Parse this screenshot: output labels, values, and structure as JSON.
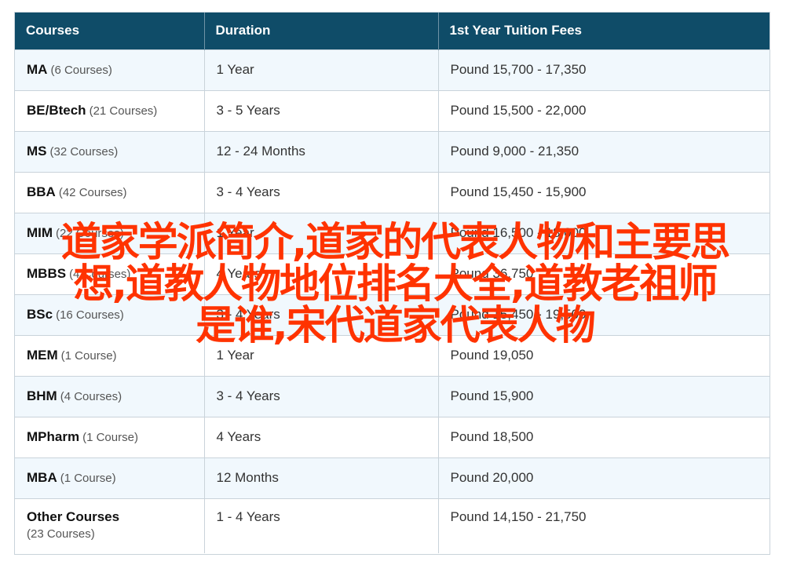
{
  "table": {
    "headers": [
      "Courses",
      "Duration",
      "1st Year Tuition Fees"
    ],
    "rows": [
      {
        "course": "MA",
        "count": "(6 Courses)",
        "duration": "1 Year",
        "fees": "Pound 15,700 - 17,350"
      },
      {
        "course": "BE/Btech",
        "count": "(21 Courses)",
        "duration": "3 - 5 Years",
        "fees": "Pound 15,500 - 22,000"
      },
      {
        "course": "MS",
        "count": "(32 Courses)",
        "duration": "12 - 24 Months",
        "fees": "Pound 9,000 - 21,350"
      },
      {
        "course": "BBA",
        "count": "(42 Courses)",
        "duration": "3 - 4 Years",
        "fees": "Pound 15,450 - 15,900"
      },
      {
        "course": "MIM",
        "count": "(22 Courses)",
        "duration": "1 Year",
        "fees": "Pound 16,500 - 18,000"
      },
      {
        "course": "MBBS",
        "count": "(4 Courses)",
        "duration": "4 Years",
        "fees": "Pound 36,750"
      },
      {
        "course": "BSc",
        "count": "(16 Courses)",
        "duration": "3 - 4 Years",
        "fees": "Pound 15,450 - 19,500"
      },
      {
        "course": "MEM",
        "count": "(1 Course)",
        "duration": "1 Year",
        "fees": "Pound 19,050"
      },
      {
        "course": "BHM",
        "count": "(4 Courses)",
        "duration": "3 - 4 Years",
        "fees": "Pound 15,900"
      },
      {
        "course": "MPharm",
        "count": "(1 Course)",
        "duration": "4 Years",
        "fees": "Pound 18,500"
      },
      {
        "course": "MBA",
        "count": "(1 Course)",
        "duration": "12 Months",
        "fees": "Pound 20,000"
      },
      {
        "course": "Other Courses",
        "count": "(23 Courses)",
        "duration": "1 - 4 Years",
        "fees": "Pound 14,150 - 21,750"
      }
    ]
  },
  "overlay": {
    "lines": [
      "道家学派简介,道家的代表人物和主要思",
      "想,道教人物地位排名大全,道教老祖师",
      "是谁,宋代道家代表人物"
    ],
    "color": "#ff3300"
  },
  "colors": {
    "header_bg": "#0f4c68",
    "row_alt_bg": "#f1f8fd",
    "border": "#c9d3da"
  }
}
